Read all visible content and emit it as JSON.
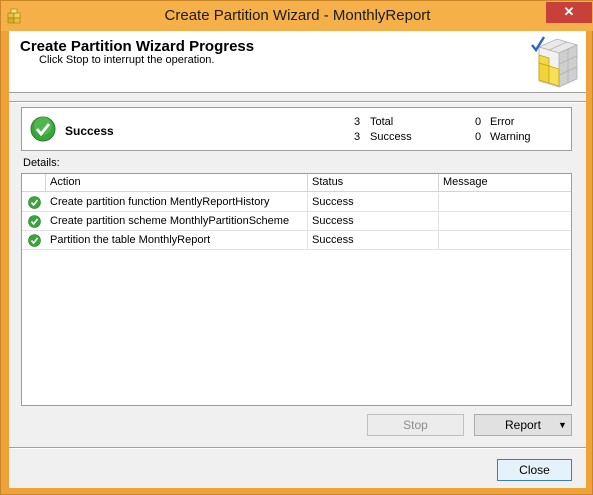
{
  "window": {
    "title": "Create Partition Wizard - MonthlyReport",
    "close_glyph": "✕"
  },
  "header": {
    "title": "Create Partition Wizard Progress",
    "subtitle": "Click Stop to interrupt the operation."
  },
  "summary": {
    "status": "Success",
    "total_count": "3",
    "total_label": "Total",
    "success_count": "3",
    "success_label": "Success",
    "error_count": "0",
    "error_label": "Error",
    "warning_count": "0",
    "warning_label": "Warning"
  },
  "details": {
    "label": "Details:",
    "columns": {
      "action": "Action",
      "status": "Status",
      "message": "Message"
    },
    "rows": [
      {
        "action": "Create partition function MentlyReportHistory",
        "status": "Success",
        "message": ""
      },
      {
        "action": "Create partition scheme MonthlyPartitionScheme",
        "status": "Success",
        "message": ""
      },
      {
        "action": "Partition the table MonthlyReport",
        "status": "Success",
        "message": ""
      }
    ]
  },
  "buttons": {
    "stop": "Stop",
    "report": "Report",
    "report_arrow": "▼",
    "close": "Close"
  },
  "colors": {
    "title_bar": "#f6b04a",
    "success_green": "#3aa53a",
    "close_red": "#c7413a"
  }
}
